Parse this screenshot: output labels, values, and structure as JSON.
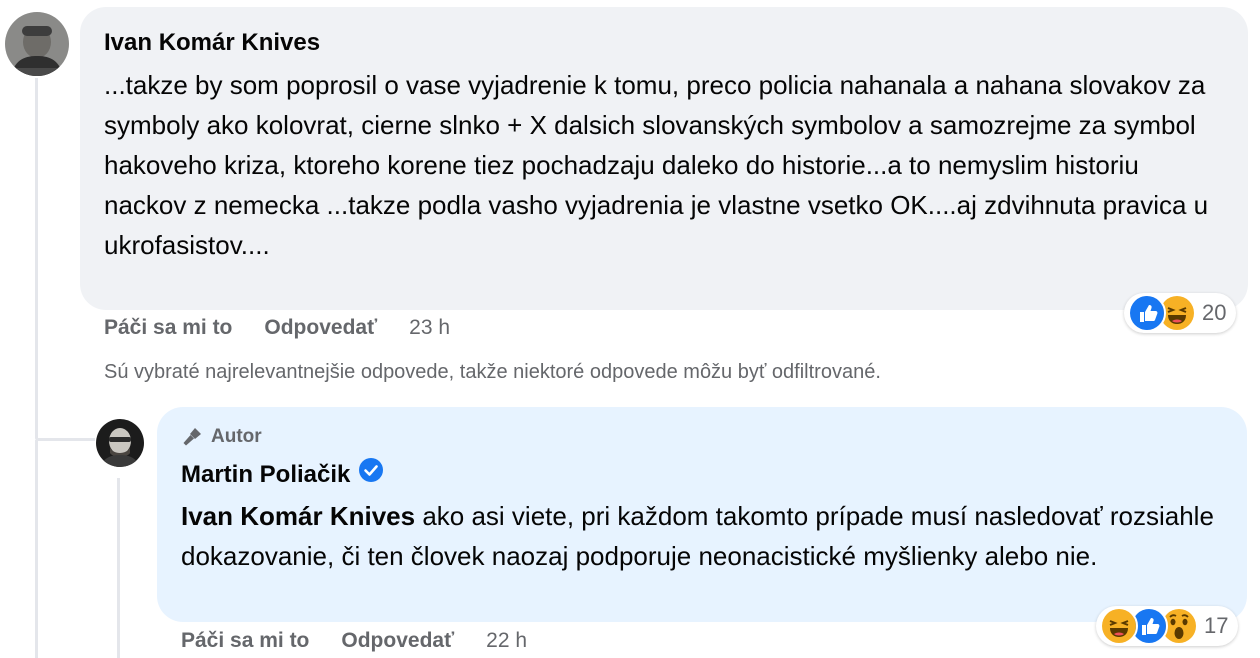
{
  "comment": {
    "author": "Ivan Komár Knives",
    "text": "...takze by som poprosil o vase vyjadrenie k tomu, preco policia nahanala a nahana slovakov za symboly ako kolovrat, cierne slnko + X dalsich slovanských symbolov a samozrejme za symbol hakoveho kriza, ktoreho korene tiez pochadzaju daleko do historie...a to nemyslim historiu nackov z nemecka ...takze podla vasho vyjadrenia je vlastne vsetko OK....aj zdvihnuta pravica u ukrofasistov....",
    "like_label": "Páči sa mi to",
    "reply_label": "Odpovedať",
    "time": "23 h",
    "reaction_icons": [
      "like-icon",
      "haha-icon"
    ],
    "reaction_count": "20"
  },
  "notice": "Sú vybraté najrelevantnejšie odpovede, takže niektoré odpovede môžu byť odfiltrované.",
  "reply": {
    "badge": "Autor",
    "author": "Martin Poliačik",
    "mention": "Ivan Komár Knives",
    "text": " ako asi viete, pri každom takomto prípade musí nasledovať rozsiahle dokazovanie, či ten človek naozaj podporuje neonacistické myšlienky alebo nie.",
    "like_label": "Páči sa mi to",
    "reply_label": "Odpovedať",
    "time": "22 h",
    "reaction_icons": [
      "haha-icon",
      "like-icon",
      "wow-icon"
    ],
    "reaction_count": "17"
  },
  "colors": {
    "bubble_gray": "#f0f2f5",
    "bubble_blue": "#e7f3ff",
    "secondary_text": "#65676b",
    "verified_blue": "#1877f2"
  }
}
